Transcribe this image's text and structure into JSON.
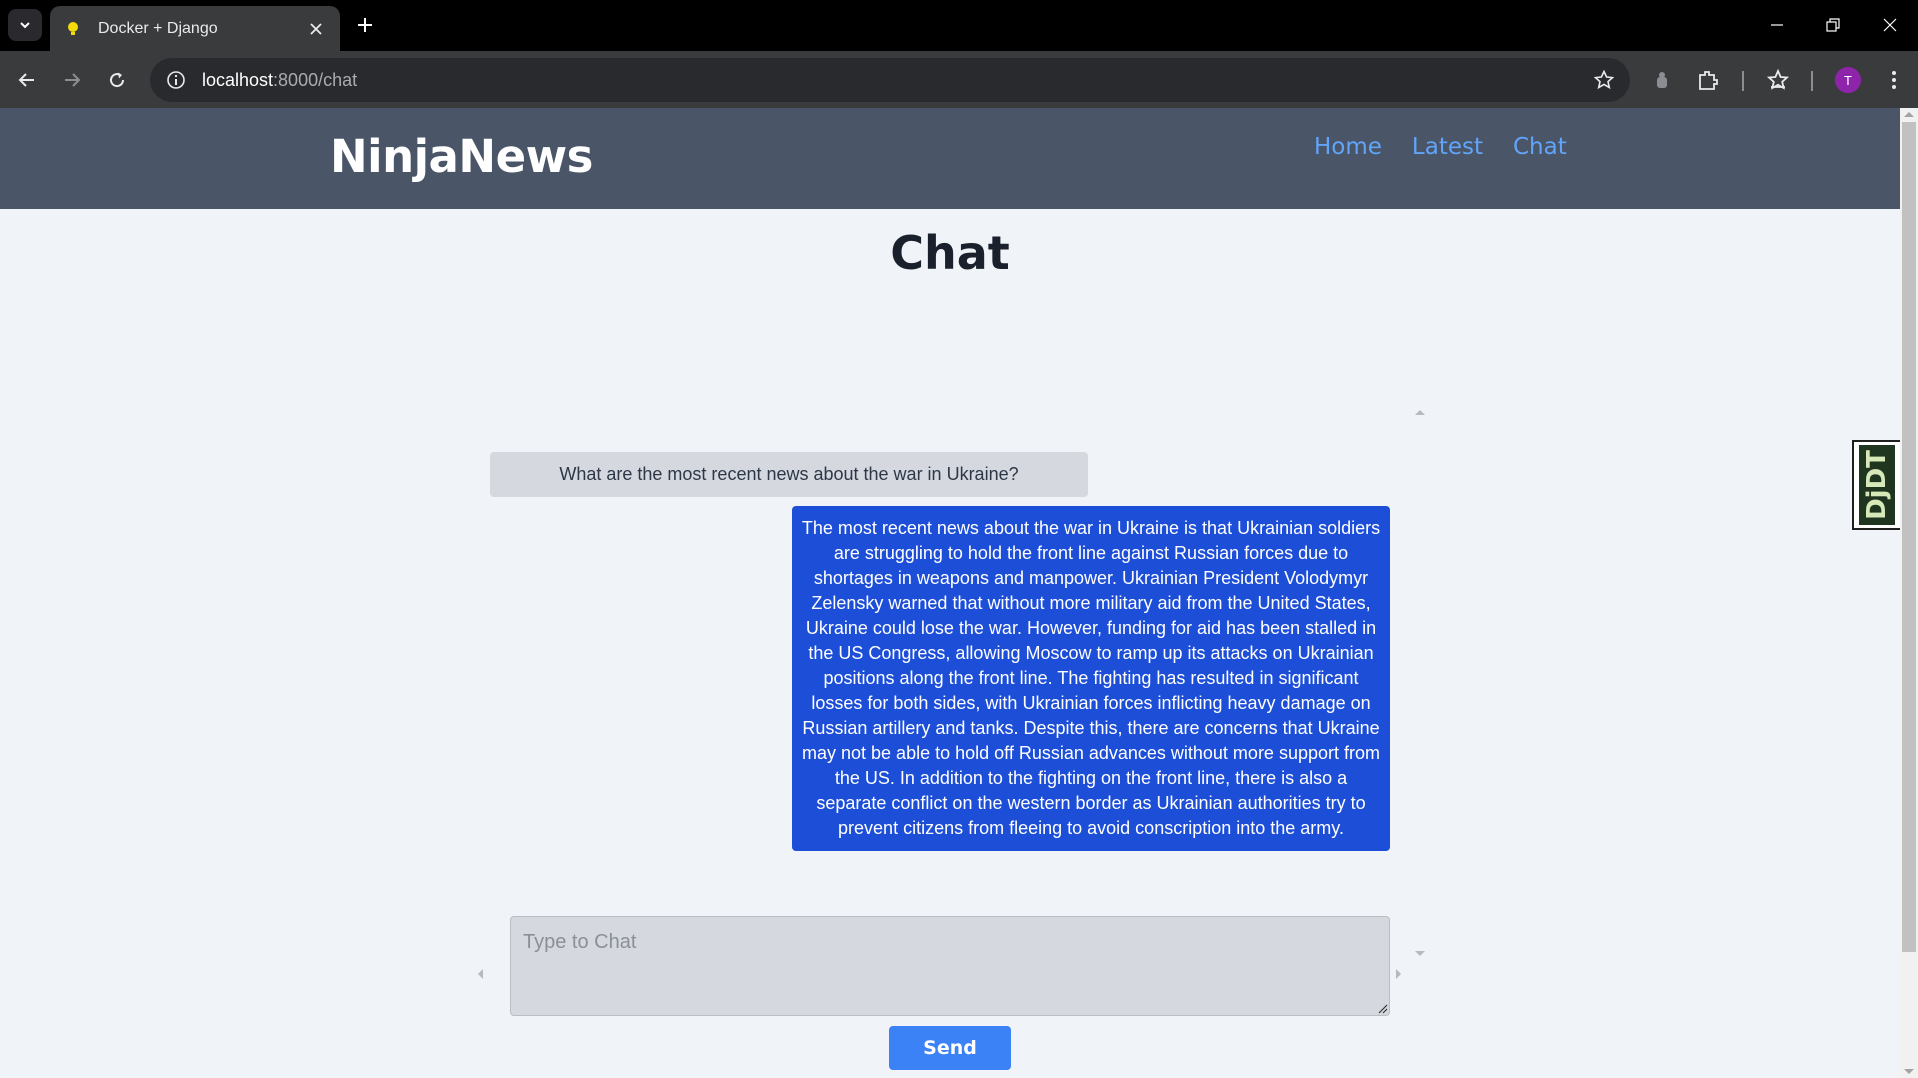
{
  "browser": {
    "tab_title": "Docker + Django",
    "url_host": "localhost",
    "url_path": ":8000/chat",
    "profile_initial": "T",
    "profile_color": "#8e24aa"
  },
  "site": {
    "brand": "NinjaNews",
    "nav": {
      "home": "Home",
      "latest": "Latest",
      "chat": "Chat"
    },
    "nav_color": "#4a5568",
    "link_color": "#60a5fa"
  },
  "chat": {
    "heading": "Chat",
    "messages": [
      {
        "role": "user",
        "text": "What are the most recent news about the war in Ukraine?"
      },
      {
        "role": "assistant",
        "text": "The most recent news about the war in Ukraine is that Ukrainian soldiers are struggling to hold the front line against Russian forces due to shortages in weapons and manpower. Ukrainian President Volodymyr Zelensky warned that without more military aid from the United States, Ukraine could lose the war. However, funding for aid has been stalled in the US Congress, allowing Moscow to ramp up its attacks on Ukrainian positions along the front line. The fighting has resulted in significant losses for both sides, with Ukrainian forces inflicting heavy damage on Russian artillery and tanks. Despite this, there are concerns that Ukraine may not be able to hold off Russian advances without more support from the US. In addition to the fighting on the front line, there is also a separate conflict on the western border as Ukrainian authorities try to prevent citizens from fleeing to avoid conscription into the army."
      }
    ],
    "input_placeholder": "Type to Chat",
    "send_label": "Send",
    "assistant_bubble_color": "#1d4ed8",
    "send_button_color": "#3b82f6"
  },
  "debug_toolbar": {
    "label": "DjDT"
  }
}
